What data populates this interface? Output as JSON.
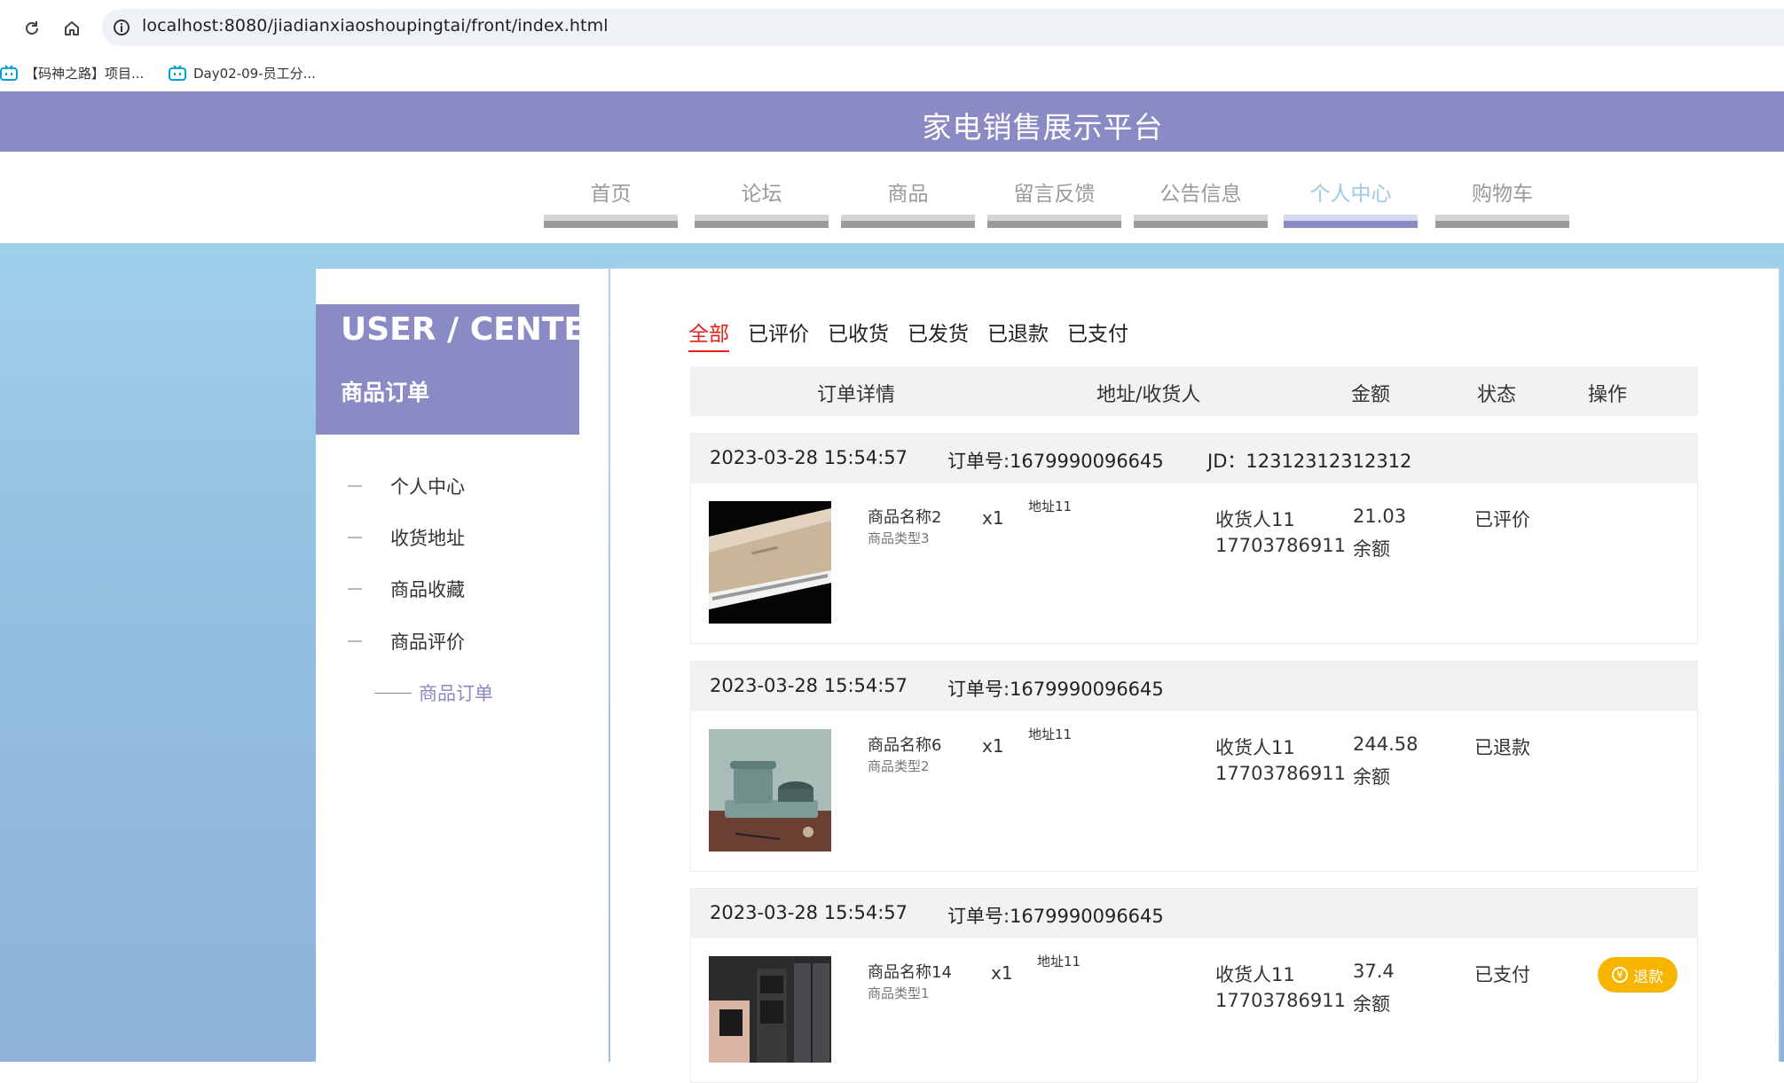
{
  "browser": {
    "url": "localhost:8080/jiadianxiaoshoupingtai/front/index.html",
    "bookmarks": [
      {
        "label": "【码神之路】项目..."
      },
      {
        "label": "Day02-09-员工分..."
      }
    ]
  },
  "site": {
    "title": "家电销售展示平台",
    "nav": [
      {
        "label": "首页"
      },
      {
        "label": "论坛"
      },
      {
        "label": "商品"
      },
      {
        "label": "留言反馈"
      },
      {
        "label": "公告信息"
      },
      {
        "label": "个人中心",
        "active": true
      },
      {
        "label": "购物车"
      }
    ]
  },
  "sidebar": {
    "title_en": "USER / CENTER",
    "title_cn": "商品订单",
    "items": [
      {
        "label": "个人中心"
      },
      {
        "label": "收货地址"
      },
      {
        "label": "商品收藏"
      },
      {
        "label": "商品评价"
      },
      {
        "label": "商品订单",
        "active": true
      }
    ]
  },
  "main": {
    "tabs": [
      {
        "label": "全部",
        "active": true
      },
      {
        "label": "已评价"
      },
      {
        "label": "已收货"
      },
      {
        "label": "已发货"
      },
      {
        "label": "已退款"
      },
      {
        "label": "已支付"
      }
    ],
    "columns": [
      "订单详情",
      "地址/收货人",
      "金额",
      "状态",
      "操作"
    ],
    "orders": [
      {
        "time": "2023-03-28 15:54:57",
        "order_no": "订单号:1679990096645",
        "jd": "JD：12312312312312",
        "product_name": "商品名称2",
        "product_type": "商品类型3",
        "qty": "x1",
        "address": "地址11",
        "receiver": "收货人11",
        "phone": "17703786911",
        "amount": "21.03",
        "pay_method": "余额",
        "status": "已评价",
        "image": "air-conditioner"
      },
      {
        "time": "2023-03-28 15:54:57",
        "order_no": "订单号:1679990096645",
        "jd": "",
        "product_name": "商品名称6",
        "product_type": "商品类型2",
        "qty": "x1",
        "address": "地址11",
        "receiver": "收货人11",
        "phone": "17703786911",
        "amount": "244.58",
        "pay_method": "余额",
        "status": "已退款",
        "image": "cooking-pot"
      },
      {
        "time": "2023-03-28 15:54:57",
        "order_no": "订单号:1679990096645",
        "jd": "",
        "product_name": "商品名称14",
        "product_type": "商品类型1",
        "qty": "x1",
        "address": "地址11",
        "receiver": "收货人11",
        "phone": "17703786911",
        "amount": "37.4",
        "pay_method": "余额",
        "status": "已支付",
        "action": "退款",
        "image": "kitchen-appliances"
      }
    ]
  },
  "colors": {
    "brand": "#8a8ac4",
    "active_tab": "#e2211c",
    "refund_button": "#f7b500"
  }
}
